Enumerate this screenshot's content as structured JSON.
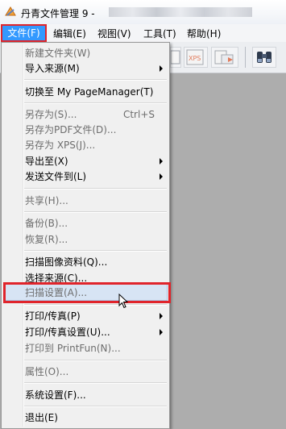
{
  "window": {
    "title": "丹青文件管理 9  -",
    "title_redacted": true
  },
  "menubar": {
    "items": [
      {
        "label": "文件(F)",
        "active": true
      },
      {
        "label": "编辑(E)"
      },
      {
        "label": "视图(V)"
      },
      {
        "label": "工具(T)"
      },
      {
        "label": "帮助(H)"
      }
    ]
  },
  "toolbar": {
    "icons": [
      "document-icon",
      "xps-icon",
      "export-icon",
      "binoculars-icon"
    ],
    "xps_label": "XPS"
  },
  "file_menu": {
    "items": [
      {
        "label": "新建文件夹(W)",
        "disabled": true
      },
      {
        "label": "导入来源(M)",
        "submenu": true
      },
      {
        "label": "切换至 My PageManager(T)"
      },
      {
        "label": "另存为(S)...",
        "shortcut": "Ctrl+S",
        "disabled": true
      },
      {
        "label": "另存为PDF文件(D)...",
        "disabled": true
      },
      {
        "label": "另存为 XPS(J)...",
        "disabled": true
      },
      {
        "label": "导出至(X)",
        "submenu": true
      },
      {
        "label": "发送文件到(L)",
        "submenu": true
      },
      {
        "label": "共享(H)...",
        "disabled": true
      },
      {
        "label": "备份(B)...",
        "disabled": true
      },
      {
        "label": "恢复(R)...",
        "disabled": true
      },
      {
        "label": "扫描图像资料(Q)..."
      },
      {
        "label": "选择来源(C)..."
      },
      {
        "label": "扫描设置(A)...",
        "disabled": true,
        "highlighted": true
      },
      {
        "label": "打印/传真(P)",
        "submenu": true
      },
      {
        "label": "打印/传真设置(U)...",
        "submenu": true
      },
      {
        "label": "打印到 PrintFun(N)...",
        "disabled": true
      },
      {
        "label": "属性(O)...",
        "disabled": true
      },
      {
        "label": "系统设置(F)..."
      },
      {
        "label": "退出(E)"
      }
    ]
  },
  "colors": {
    "annotation_red": "#e0242b",
    "menu_active_bg": "#3399ff",
    "disabled_text": "#6d6d6d"
  }
}
